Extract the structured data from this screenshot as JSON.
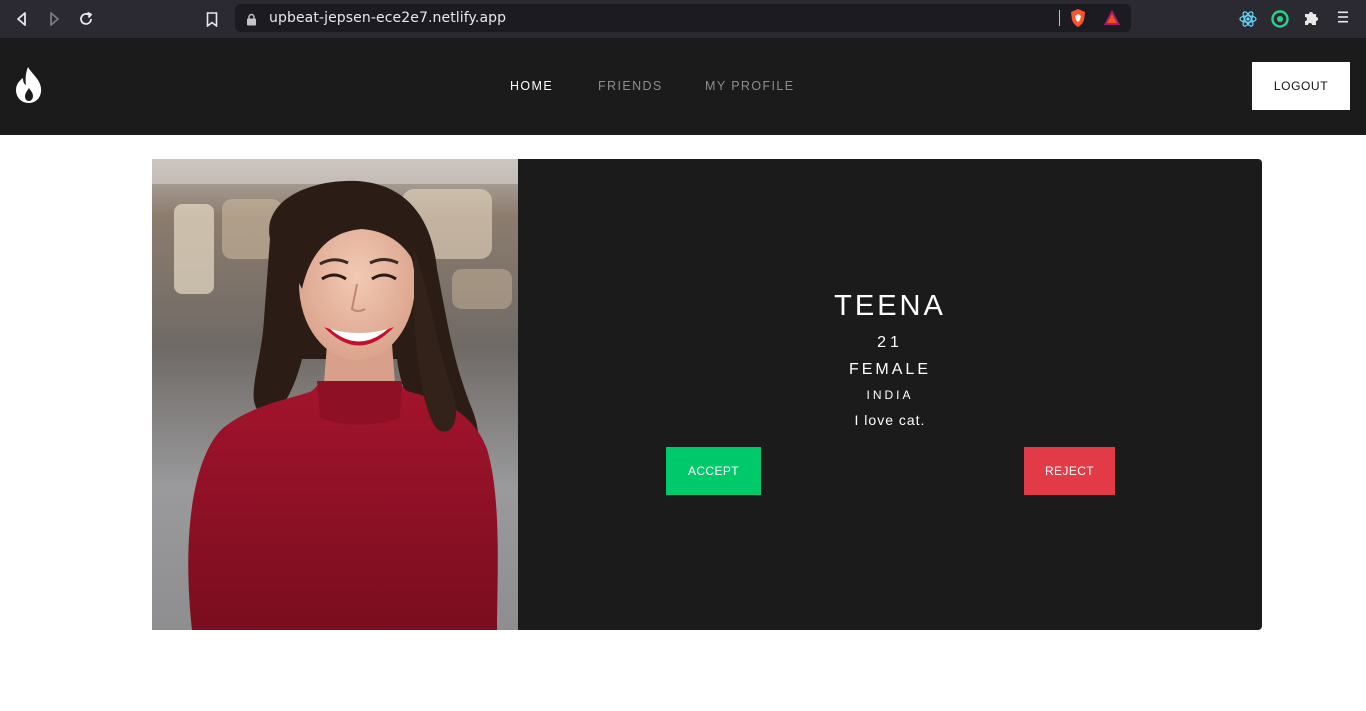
{
  "browser": {
    "url": "upbeat-jepsen-ece2e7.netlify.app",
    "icons": [
      "back-icon",
      "forward-icon",
      "reload-icon",
      "bookmark-icon",
      "lock-icon",
      "brave-shield-icon",
      "brave-rewards-icon",
      "react-devtools-icon",
      "extension-ring-icon",
      "puzzle-icon",
      "menu-icon"
    ]
  },
  "header": {
    "logo_icon": "flame-logo-icon",
    "nav": [
      {
        "label": "HOME",
        "active": true
      },
      {
        "label": "FRIENDS",
        "active": false
      },
      {
        "label": "MY PROFILE",
        "active": false
      }
    ],
    "logout_label": "LOGOUT"
  },
  "profile": {
    "name": "TEENA",
    "age": "21",
    "gender": "FEMALE",
    "country": "INDIA",
    "bio": "I love cat.",
    "accept_label": "ACCEPT",
    "reject_label": "REJECT"
  },
  "colors": {
    "header_bg": "#1b1b1b",
    "card_bg": "#1b1b1b",
    "accept": "#00c96b",
    "reject": "#e23a46"
  }
}
